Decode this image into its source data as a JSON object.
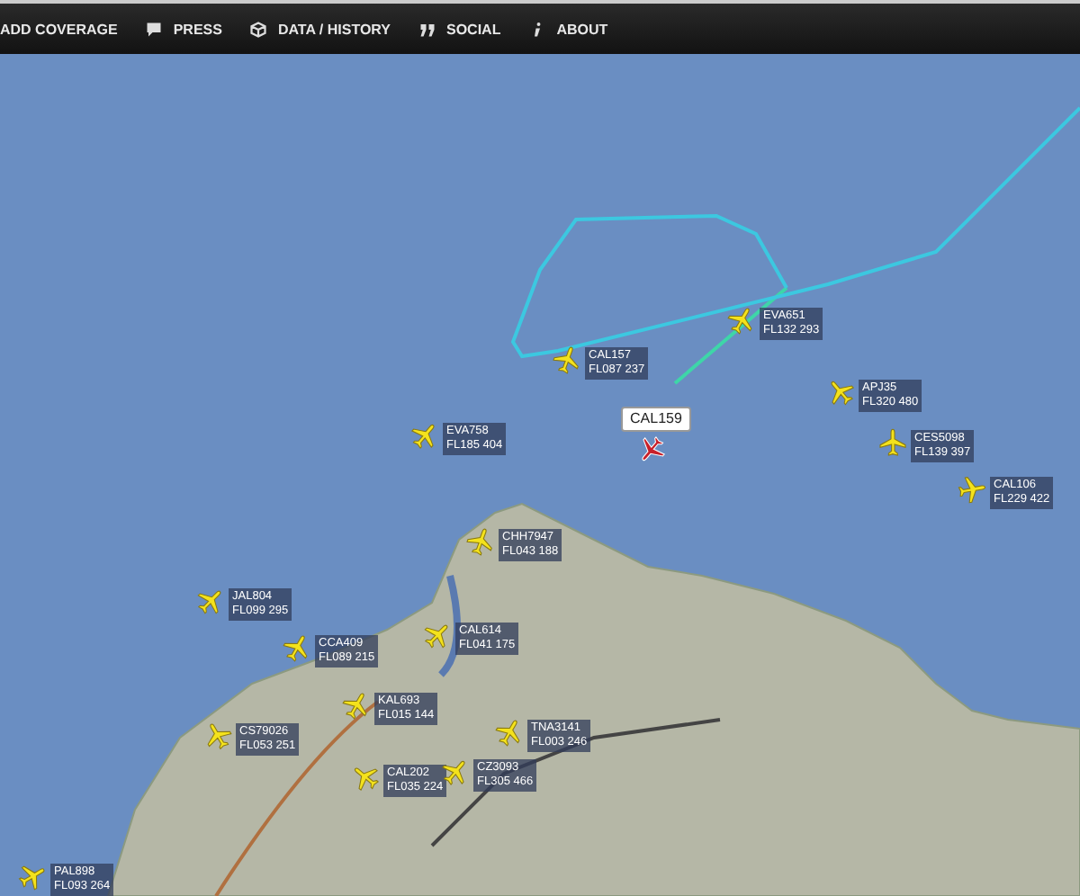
{
  "nav": [
    {
      "label": "ADD COVERAGE"
    },
    {
      "label": "PRESS"
    },
    {
      "label": "DATA / HISTORY"
    },
    {
      "label": "SOCIAL"
    },
    {
      "label": "ABOUT"
    }
  ],
  "flights": [
    {
      "callsign": "EVA651",
      "altitude": "FL132 293",
      "selected": false
    },
    {
      "callsign": "CAL157",
      "altitude": "FL087 237",
      "selected": false
    },
    {
      "callsign": "EVA758",
      "altitude": "FL185 404",
      "selected": false
    },
    {
      "callsign": "CAL159",
      "selected": true
    },
    {
      "callsign": "APJ35",
      "altitude": "FL320 480",
      "selected": false
    },
    {
      "callsign": "CES5098",
      "altitude": "FL139 397",
      "selected": false
    },
    {
      "callsign": "CAL106",
      "altitude": "FL229 422",
      "selected": false
    },
    {
      "callsign": "CHH7947",
      "altitude": "FL043 188",
      "selected": false
    },
    {
      "callsign": "JAL804",
      "altitude": "FL099 295",
      "selected": false
    },
    {
      "callsign": "CCA409",
      "altitude": "FL089 215",
      "selected": false
    },
    {
      "callsign": "CAL614",
      "altitude": "FL041 175",
      "selected": false
    },
    {
      "callsign": "KAL693",
      "altitude": "FL015 144",
      "selected": false
    },
    {
      "callsign": "CS79026",
      "altitude": "FL053 251",
      "selected": false
    },
    {
      "callsign": "CAL202",
      "altitude": "FL035 224",
      "selected": false
    },
    {
      "callsign": "CZ3093",
      "altitude": "FL305 466",
      "selected": false
    },
    {
      "callsign": "TNA3141",
      "altitude": "FL003 246",
      "selected": false
    },
    {
      "callsign": "PAL898",
      "altitude": "FL093 264",
      "selected": false
    }
  ]
}
